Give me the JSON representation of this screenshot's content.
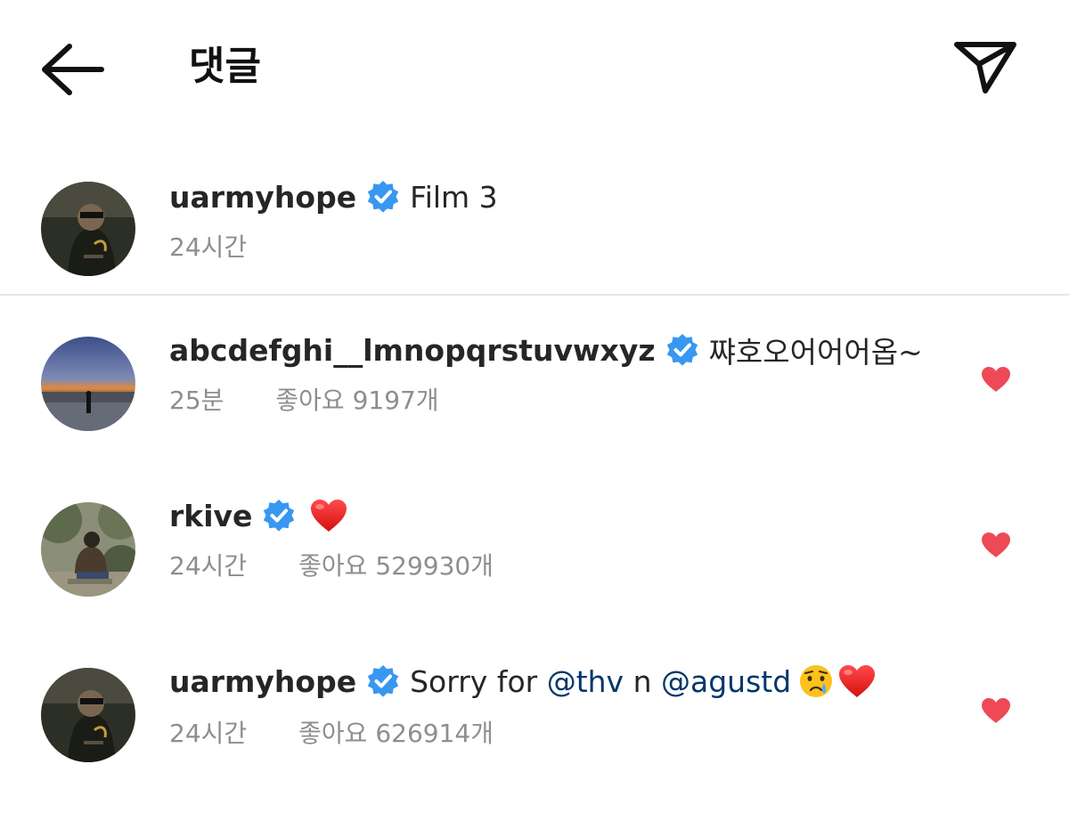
{
  "header": {
    "title": "댓글",
    "back_icon": "arrow-left-icon",
    "share_icon": "paper-plane-icon"
  },
  "caption": {
    "username": "uarmyhope",
    "verified": true,
    "text": "Film 3",
    "time": "24시간"
  },
  "comments": [
    {
      "username": "abcdefghi__lmnopqrstuvwxyz",
      "verified": true,
      "text": "쨔호오어어어옵~",
      "time": "25분",
      "likes": "좋아요 9197개",
      "liked": true
    },
    {
      "username": "rkive",
      "verified": true,
      "text": "",
      "emoji": "red-heart",
      "time": "24시간",
      "likes": "좋아요 529930개",
      "liked": true
    },
    {
      "username": "uarmyhope",
      "verified": true,
      "text_before": "Sorry for ",
      "mention1": "@thv",
      "text_mid": " n ",
      "mention2": "@agustd",
      "emoji": [
        "crying-face",
        "red-heart"
      ],
      "time": "24시간",
      "likes": "좋아요 626914개",
      "liked": true
    }
  ],
  "colors": {
    "verified_badge": "#3897f0",
    "like_heart": "#ed4956",
    "mention": "#00376b",
    "secondary_text": "#8e8e8e"
  }
}
